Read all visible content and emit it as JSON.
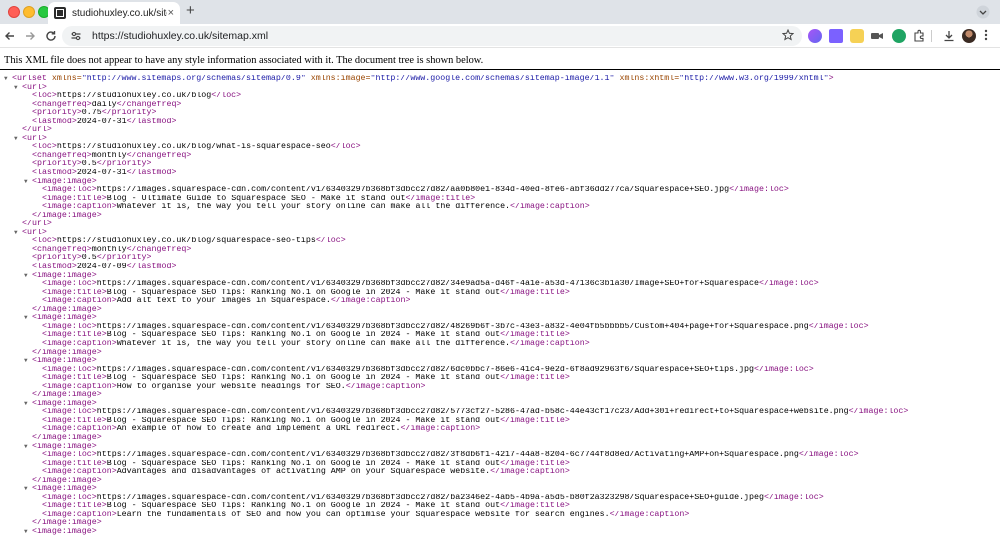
{
  "browser": {
    "tab_title": "studiohuxley.co.uk/sitemap.xml",
    "url": "https://studiohuxley.co.uk/sitemap.xml",
    "tab_close": "×",
    "new_tab": "+"
  },
  "viewer": {
    "info": "This XML file does not appear to have any style information associated with it. The document tree is shown below."
  },
  "xml": {
    "root_open": "<urlset xmlns=\"http://www.sitemaps.org/schemas/sitemap/0.9\" xmlns:image=\"http://www.google.com/schemas/sitemap-image/1.1\" xmlns:xhtml=\"http://www.w3.org/1999/xhtml\">",
    "lines": [
      {
        "indent": 0,
        "toggle": true,
        "text": "<urlset xmlns=\"http://www.sitemaps.org/schemas/sitemap/0.9\" xmlns:image=\"http://www.google.com/schemas/sitemap-image/1.1\" xmlns:xhtml=\"http://www.w3.org/1999/xhtml\">"
      },
      {
        "indent": 1,
        "toggle": true,
        "text": "<url>"
      },
      {
        "indent": 2,
        "toggle": false,
        "text": "<loc>https://studiohuxley.co.uk/blog</loc>"
      },
      {
        "indent": 2,
        "toggle": false,
        "text": "<changefreq>daily</changefreq>"
      },
      {
        "indent": 2,
        "toggle": false,
        "text": "<priority>0.75</priority>"
      },
      {
        "indent": 2,
        "toggle": false,
        "text": "<lastmod>2024-07-31</lastmod>"
      },
      {
        "indent": 1,
        "toggle": false,
        "text": "</url>"
      },
      {
        "indent": 1,
        "toggle": true,
        "text": "<url>"
      },
      {
        "indent": 2,
        "toggle": false,
        "text": "<loc>https://studiohuxley.co.uk/blog/what-is-squarespace-seo</loc>"
      },
      {
        "indent": 2,
        "toggle": false,
        "text": "<changefreq>monthly</changefreq>"
      },
      {
        "indent": 2,
        "toggle": false,
        "text": "<priority>0.5</priority>"
      },
      {
        "indent": 2,
        "toggle": false,
        "text": "<lastmod>2024-07-31</lastmod>"
      },
      {
        "indent": 2,
        "toggle": true,
        "text": "<image:image>"
      },
      {
        "indent": 3,
        "toggle": false,
        "text": "<image:loc>https://images.squarespace-cdn.com/content/v1/63403297b368bf3dbcc27d82/aa0b80e1-834d-40ed-8fe6-abf36dd277ca/Squarespace+SEO.jpg</image:loc>"
      },
      {
        "indent": 3,
        "toggle": false,
        "text": "<image:title>Blog - Ultimate Guide to Squarespace SEO - Make it stand out</image:title>"
      },
      {
        "indent": 3,
        "toggle": false,
        "text": "<image:caption>Whatever it is, the way you tell your story online can make all the difference.</image:caption>"
      },
      {
        "indent": 2,
        "toggle": false,
        "text": "</image:image>"
      },
      {
        "indent": 1,
        "toggle": false,
        "text": "</url>"
      },
      {
        "indent": 1,
        "toggle": true,
        "text": "<url>"
      },
      {
        "indent": 2,
        "toggle": false,
        "text": "<loc>https://studiohuxley.co.uk/blog/squarespace-seo-tips</loc>"
      },
      {
        "indent": 2,
        "toggle": false,
        "text": "<changefreq>monthly</changefreq>"
      },
      {
        "indent": 2,
        "toggle": false,
        "text": "<priority>0.5</priority>"
      },
      {
        "indent": 2,
        "toggle": false,
        "text": "<lastmod>2024-07-09</lastmod>"
      },
      {
        "indent": 2,
        "toggle": true,
        "text": "<image:image>"
      },
      {
        "indent": 3,
        "toggle": false,
        "text": "<image:loc>https://images.squarespace-cdn.com/content/v1/63403297b368bf3dbcc27d82/34e9ad5a-d46f-4a1e-a53d-47136c3b1a30/Image+SEO+for+Squarespace</image:loc>"
      },
      {
        "indent": 3,
        "toggle": false,
        "text": "<image:title>Blog - Squarespace SEO Tips: Ranking No.1 on Google in 2024 - Make it stand out</image:title>"
      },
      {
        "indent": 3,
        "toggle": false,
        "text": "<image:caption>Add alt text to your images in Squarespace.</image:caption>"
      },
      {
        "indent": 2,
        "toggle": false,
        "text": "</image:image>"
      },
      {
        "indent": 2,
        "toggle": true,
        "text": "<image:image>"
      },
      {
        "indent": 3,
        "toggle": false,
        "text": "<image:loc>https://images.squarespace-cdn.com/content/v1/63403297b368bf3dbcc27d82/48269b6f-3b7c-43e3-a832-4e04fb5bbbb5/Custom+404+page+for+Squarespace.png</image:loc>"
      },
      {
        "indent": 3,
        "toggle": false,
        "text": "<image:title>Blog - Squarespace SEO Tips: Ranking No.1 on Google in 2024 - Make it stand out</image:title>"
      },
      {
        "indent": 3,
        "toggle": false,
        "text": "<image:caption>Whatever it is, the way you tell your story online can make all the difference.</image:caption>"
      },
      {
        "indent": 2,
        "toggle": false,
        "text": "</image:image>"
      },
      {
        "indent": 2,
        "toggle": true,
        "text": "<image:image>"
      },
      {
        "indent": 3,
        "toggle": false,
        "text": "<image:loc>https://images.squarespace-cdn.com/content/v1/63403297b368bf3dbcc27d82/6dc0bbc7-86e6-41c4-9e2d-6f8ad92963f6/Squarespace+SEO+tips.jpg</image:loc>"
      },
      {
        "indent": 3,
        "toggle": false,
        "text": "<image:title>Blog - Squarespace SEO Tips: Ranking No.1 on Google in 2024 - Make it stand out</image:title>"
      },
      {
        "indent": 3,
        "toggle": false,
        "text": "<image:caption>How to organise your website headings for SEO.</image:caption>"
      },
      {
        "indent": 2,
        "toggle": false,
        "text": "</image:image>"
      },
      {
        "indent": 2,
        "toggle": true,
        "text": "<image:image>"
      },
      {
        "indent": 3,
        "toggle": false,
        "text": "<image:loc>https://images.squarespace-cdn.com/content/v1/63403297b368bf3dbcc27d82/5773cf27-5286-47ad-b58c-44e43cf17c23/Add+301+redirect+to+Squarespace+website.png</image:loc>"
      },
      {
        "indent": 3,
        "toggle": false,
        "text": "<image:title>Blog - Squarespace SEO Tips: Ranking No.1 on Google in 2024 - Make it stand out</image:title>"
      },
      {
        "indent": 3,
        "toggle": false,
        "text": "<image:caption>An example of how to create and implement a URL redirect.</image:caption>"
      },
      {
        "indent": 2,
        "toggle": false,
        "text": "</image:image>"
      },
      {
        "indent": 2,
        "toggle": true,
        "text": "<image:image>"
      },
      {
        "indent": 3,
        "toggle": false,
        "text": "<image:loc>https://images.squarespace-cdn.com/content/v1/63403297b368bf3dbcc27d82/3f8db6f1-4217-44a8-8204-6c7744f8d8ed/Activating+AMP+on+Squarespace.png</image:loc>"
      },
      {
        "indent": 3,
        "toggle": false,
        "text": "<image:title>Blog - Squarespace SEO Tips: Ranking No.1 on Google in 2024 - Make it stand out</image:title>"
      },
      {
        "indent": 3,
        "toggle": false,
        "text": "<image:caption>Advantages and disadvantages of activating AMP on your Squarespace website.</image:caption>"
      },
      {
        "indent": 2,
        "toggle": false,
        "text": "</image:image>"
      },
      {
        "indent": 2,
        "toggle": true,
        "text": "<image:image>"
      },
      {
        "indent": 3,
        "toggle": false,
        "text": "<image:loc>https://images.squarespace-cdn.com/content/v1/63403297b368bf3dbcc27d82/ba2346e2-4ab5-4b9a-a5d5-b80f2a323298/Squarespace+SEO+guide.jpeg</image:loc>"
      },
      {
        "indent": 3,
        "toggle": false,
        "text": "<image:title>Blog - Squarespace SEO Tips: Ranking No.1 on Google in 2024 - Make it stand out</image:title>"
      },
      {
        "indent": 3,
        "toggle": false,
        "text": "<image:caption>Learn the fundamentals of SEO and how you can optimise your Squarespace website for search engines.</image:caption>"
      },
      {
        "indent": 2,
        "toggle": false,
        "text": "</image:image>"
      },
      {
        "indent": 2,
        "toggle": true,
        "text": "<image:image>"
      }
    ]
  },
  "colors": {
    "tag": "#881280",
    "attr_name": "#994500",
    "attr_value": "#1a1aa6",
    "text": "#000000"
  },
  "icons": {
    "back": "arrow-left-icon",
    "forward": "arrow-right-icon",
    "reload": "reload-icon",
    "site_info": "tune-icon",
    "bookmark": "star-icon",
    "downloads": "download-icon",
    "extensions": "puzzle-icon",
    "menu": "kebab-icon"
  }
}
